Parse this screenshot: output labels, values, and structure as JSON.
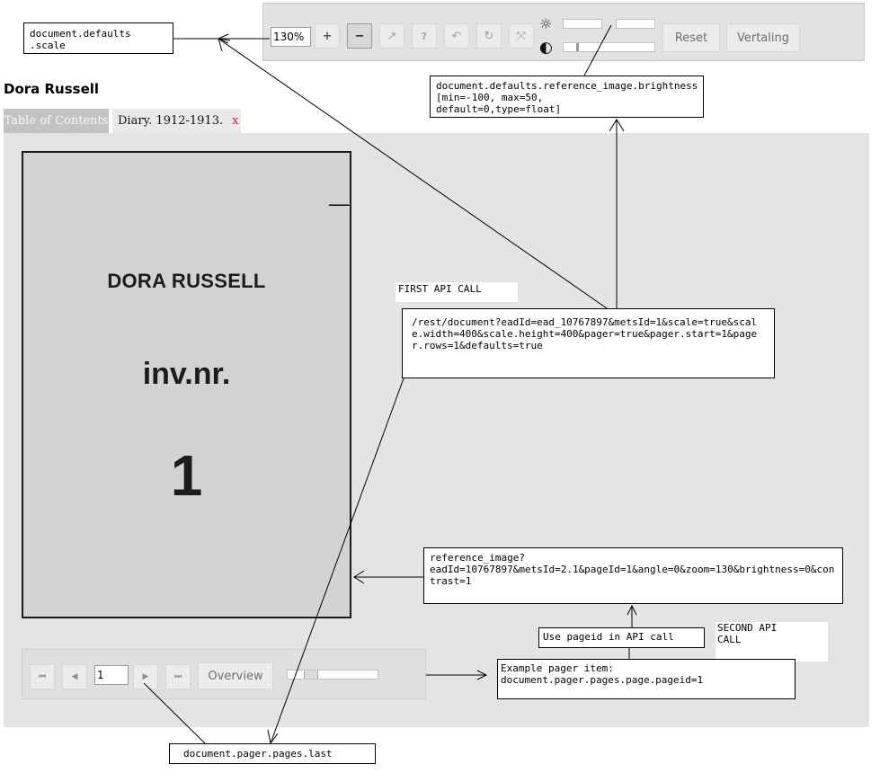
{
  "toolbar": {
    "zoom_value": "130%",
    "zoom_in_label": "+",
    "zoom_out_label": "−",
    "reset_label": "Reset",
    "translate_label": "Vertaling",
    "brightness_symbol": "☼",
    "contrast_symbol": "◐"
  },
  "header": {
    "title": "Dora Russell",
    "tabs": [
      {
        "label": "Table of Contents"
      },
      {
        "label": "Diary. 1912-1913."
      }
    ],
    "tab_close": "x"
  },
  "page_image": {
    "line1": "DORA RUSSELL",
    "line2": "inv.nr.",
    "line3": "1"
  },
  "pager": {
    "page_value": "1",
    "overview_label": "Overview"
  },
  "annotations": {
    "scale": "document.defaults\n.scale",
    "brightness": "document.defaults.reference_image.brightness[min=-100, max=50,\ndefault=0,type=float]",
    "first_api_label": "FIRST API CALL",
    "first_api_call": "/rest/document?eadId=ead_10767897&metsId=1&scale=true&scale.width=400&scale.height=400&pager=true&pager.start=1&pager.rows=1&defaults=true",
    "reference_image": "reference_image?\neadId=10767897&metsId=2.1&pageId=1&angle=0&zoom=130&brightness=0&contrast=1",
    "use_pageid": "Use pageid in API call",
    "second_api_label": "SECOND API\nCALL",
    "pager_item": "Example pager item:\ndocument.pager.pages.page.pageid=1",
    "pages_last": "document.pager.pages.last"
  }
}
